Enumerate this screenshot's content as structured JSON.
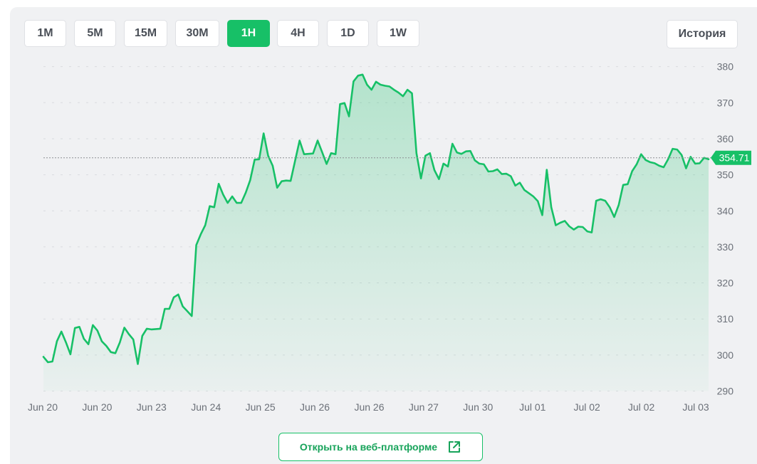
{
  "timeframes": [
    {
      "label": "1M",
      "active": false
    },
    {
      "label": "5M",
      "active": false
    },
    {
      "label": "15M",
      "active": false
    },
    {
      "label": "30M",
      "active": false
    },
    {
      "label": "1H",
      "active": true
    },
    {
      "label": "4H",
      "active": false
    },
    {
      "label": "1D",
      "active": false
    },
    {
      "label": "1W",
      "active": false
    }
  ],
  "history_label": "История",
  "open_button_label": "Открыть на веб-платформе",
  "open_button_icon": "external-link-icon",
  "colors": {
    "line": "#17c067",
    "accent": "#17c067",
    "grid": "#d9dbdf",
    "axis_text": "#6b7078",
    "current_line": "#8c8f94"
  },
  "chart_data": {
    "type": "area",
    "current_price": 354.71,
    "current_price_label": "354.71",
    "ylim": [
      288,
      383
    ],
    "yticks": [
      290,
      300,
      310,
      320,
      330,
      340,
      350,
      360,
      370,
      380
    ],
    "xtick_labels": [
      "Jun 20",
      "Jun 20",
      "Jun 23",
      "Jun 24",
      "Jun 25",
      "Jun 26",
      "Jun 26",
      "Jun 27",
      "Jun 30",
      "Jul 01",
      "Jul 02",
      "Jul 02",
      "Jul 03"
    ],
    "grid": true,
    "series": [
      {
        "values": [
          299.5,
          298,
          298.2,
          303.8,
          306.5,
          303.5,
          300.2,
          307.5,
          307.8,
          304.5,
          303,
          308.3,
          306.8,
          303.8,
          302.5,
          300.8,
          300.5,
          303.5,
          307.6,
          305.8,
          304.3,
          297.5,
          305.3,
          307.3,
          307.1,
          307.2,
          307.3,
          312.8,
          312.8,
          316,
          316.8,
          313.5,
          312.2,
          310.8,
          330.5,
          333.5,
          336,
          341.3,
          341,
          347.5,
          344.5,
          342.2,
          344,
          342.2,
          342.2,
          345,
          348.5,
          354.2,
          354.3,
          361.5,
          355.3,
          352.5,
          346.4,
          348.2,
          348.4,
          348.3,
          353.9,
          359.5,
          355.7,
          355.8,
          355.9,
          359.5,
          356.3,
          353,
          356,
          355.7,
          369.6,
          369.9,
          366.2,
          375.9,
          377.5,
          377.8,
          375,
          373.6,
          375.8,
          375,
          374.7,
          374.5,
          373.6,
          372.8,
          371.8,
          373.6,
          372.6,
          356,
          349,
          355.3,
          356,
          351.3,
          348.8,
          353.1,
          352.3,
          358.6,
          356.2,
          355.8,
          356.5,
          356.6,
          354,
          353.1,
          352.9,
          350.9,
          351,
          351.5,
          350.2,
          350.3,
          349.6,
          347,
          347.8,
          345.8,
          344.9,
          344,
          342.7,
          338.8,
          351.4,
          341,
          336,
          336.7,
          337.2,
          335.7,
          334.8,
          335.6,
          335.5,
          334.3,
          334,
          342.8,
          343.2,
          342.8,
          341,
          338.3,
          341.6,
          347.2,
          347.4,
          351,
          352.9,
          355.7,
          354.1,
          353.5,
          353.2,
          352.5,
          352.1,
          354.3,
          357.2,
          357,
          355.5,
          351.8,
          355,
          353.1,
          353.2,
          354.7,
          354.3
        ]
      }
    ]
  }
}
